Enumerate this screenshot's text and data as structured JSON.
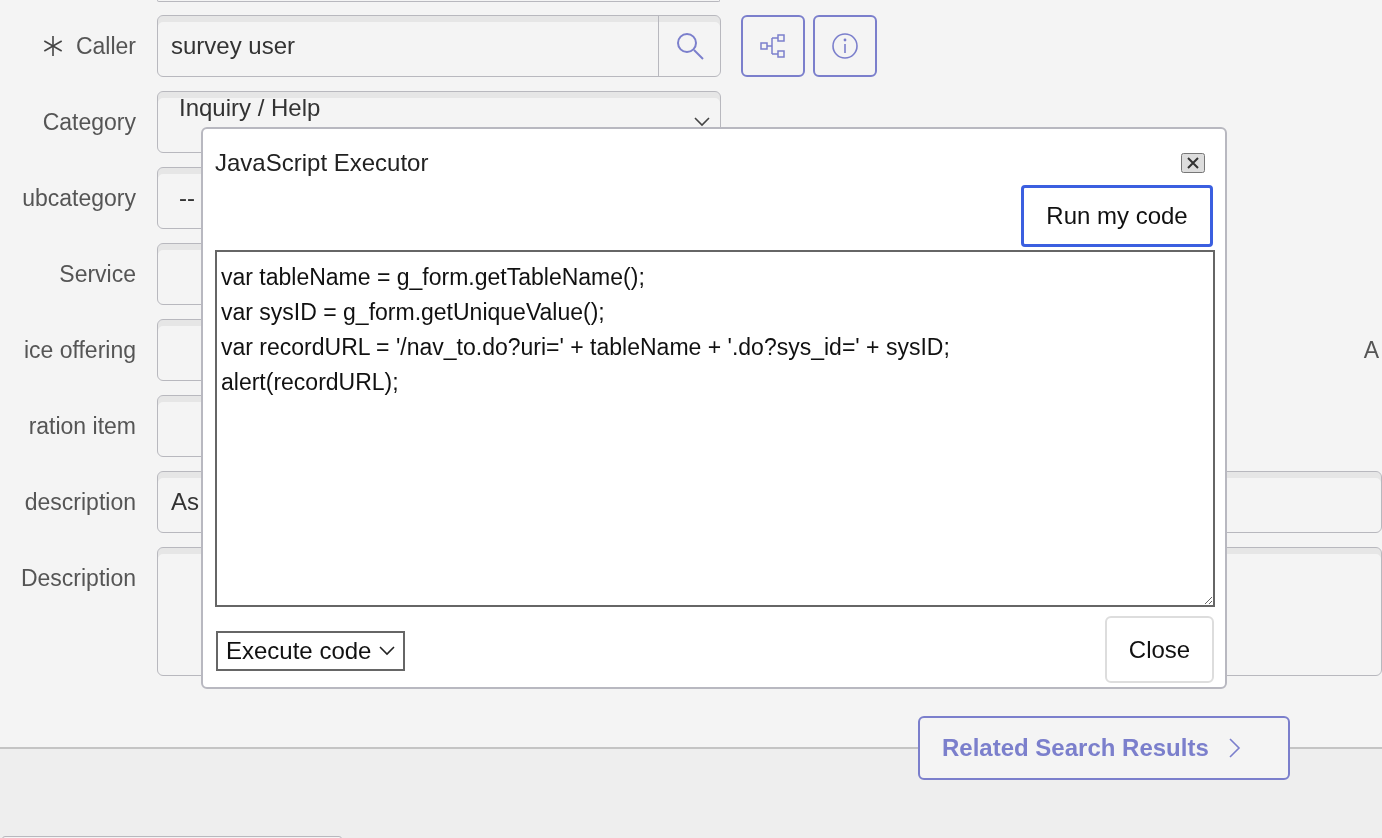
{
  "form": {
    "fields": [
      {
        "label": "Caller",
        "required": true,
        "kind": "lookup",
        "value": "survey user"
      },
      {
        "label": "Category",
        "required": false,
        "kind": "select",
        "value": "Inquiry / Help"
      },
      {
        "label": "ubcategory",
        "required": false,
        "kind": "text",
        "value": "--"
      },
      {
        "label": "Service",
        "required": false,
        "kind": "text"
      },
      {
        "label": "ice offering",
        "required": false,
        "kind": "text"
      },
      {
        "label": "ration item",
        "required": false,
        "kind": "text"
      },
      {
        "label": "description",
        "required": false,
        "kind": "wide_text",
        "value": "As"
      },
      {
        "label": "Description",
        "required": false,
        "kind": "textarea"
      }
    ],
    "right_label": "A"
  },
  "dialog": {
    "title": "JavaScript Executor",
    "run_button": "Run my code",
    "code": "var tableName = g_form.getTableName();\nvar sysID = g_form.getUniqueValue();\nvar recordURL = '/nav_to.do?uri=' + tableName + '.do?sys_id=' + sysID;\nalert(recordURL);",
    "mode_select": "Execute code",
    "close_button": "Close"
  },
  "related_button": "Related Search Results"
}
